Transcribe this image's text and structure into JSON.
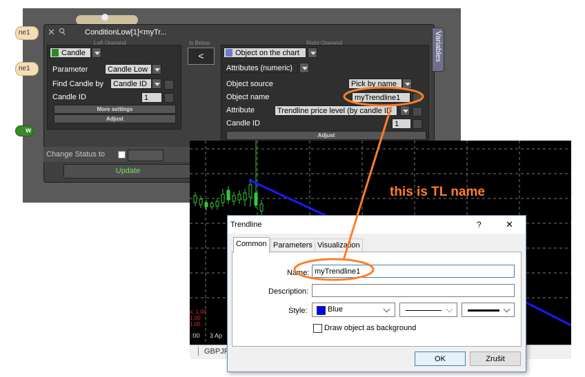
{
  "builder": {
    "left_stub_1": "ne1",
    "left_stub_2": "ne1",
    "green_stub": "w",
    "panel_title": "ConditionLow[1]<myTr...",
    "left_operand_label": "Left Operand",
    "is_below_label": "Is Below",
    "right_operand_label": "Right Operand",
    "operator_symbol": "<",
    "variables_tab": "Variables",
    "left": {
      "type": "Candle",
      "rows": [
        {
          "label": "Parameter",
          "value": "Candle Low"
        },
        {
          "label": "Find Candle by",
          "value": "Candle ID"
        },
        {
          "label": "Candle ID",
          "value": "1"
        }
      ],
      "more_settings": "More settings",
      "adjust": "Adjust"
    },
    "right": {
      "type": "Object on the chart",
      "attr_type": "Attributes (numeric)",
      "rows": [
        {
          "label": "Object source",
          "value": "Pick by name"
        },
        {
          "label": "Object name",
          "value": "myTrendline1"
        },
        {
          "label": "Attribute",
          "value": "Trendline price level (by candle ID"
        },
        {
          "label": "Candle ID",
          "value": "1"
        }
      ],
      "adjust": "Adjust"
    },
    "change_status_label": "Change Status to",
    "update_button": "Update"
  },
  "chart": {
    "symbol_tab": "GBPJP",
    "time_label_1": ":00",
    "time_label_2": "3 Ap",
    "values": [
      "x: 1.00",
      "1.00",
      "1.00"
    ],
    "colors": {
      "background": "#000000",
      "trendline": "#1a1aff",
      "candles": "#33cc33",
      "grid": "#7a7a7a"
    }
  },
  "annotation": {
    "text": "this is TL name",
    "color": "#ff7f27"
  },
  "dialog": {
    "title": "Trendline",
    "help": "?",
    "close": "✕",
    "tabs": [
      "Common",
      "Parameters",
      "Visualization"
    ],
    "name_label": "Name:",
    "name_value": "myTrendline1",
    "description_label": "Description:",
    "description_value": "",
    "style_label": "Style:",
    "color_value": "Blue",
    "color_swatch": "#0000ff",
    "draw_background_label": "Draw object as background",
    "ok_button": "OK",
    "cancel_button": "Zrušit"
  }
}
